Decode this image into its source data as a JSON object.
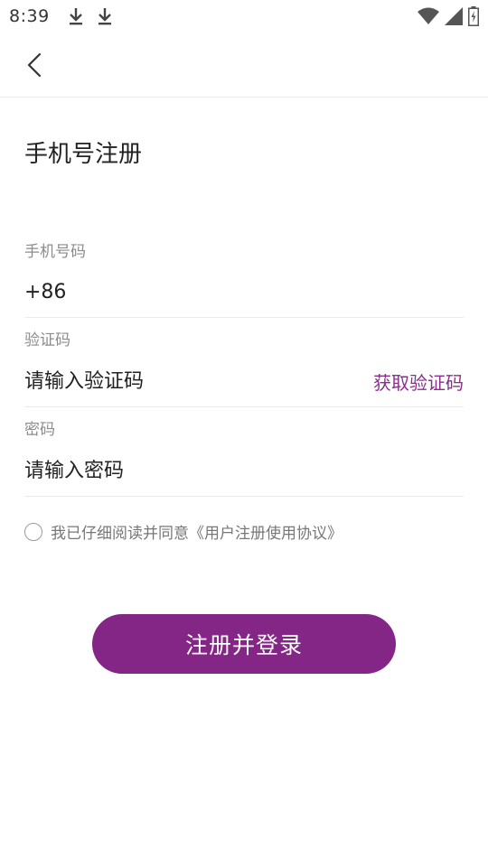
{
  "status_bar": {
    "time": "8:39",
    "icons": [
      "download-icon",
      "download-icon",
      "wifi-icon",
      "signal-icon",
      "battery-icon"
    ]
  },
  "header": {
    "back_icon": "chevron-left-icon"
  },
  "page": {
    "title": "手机号注册"
  },
  "form": {
    "phone": {
      "label": "手机号码",
      "prefix": "+86",
      "value": "",
      "placeholder": ""
    },
    "code": {
      "label": "验证码",
      "placeholder": "请输入验证码",
      "action": "获取验证码"
    },
    "password": {
      "label": "密码",
      "placeholder": "请输入密码"
    }
  },
  "agreement": {
    "checked": false,
    "text": "我已仔细阅读并同意《用户注册使用协议》"
  },
  "submit": {
    "label": "注册并登录"
  },
  "colors": {
    "accent": "#832685",
    "link": "#8a2e8c"
  }
}
